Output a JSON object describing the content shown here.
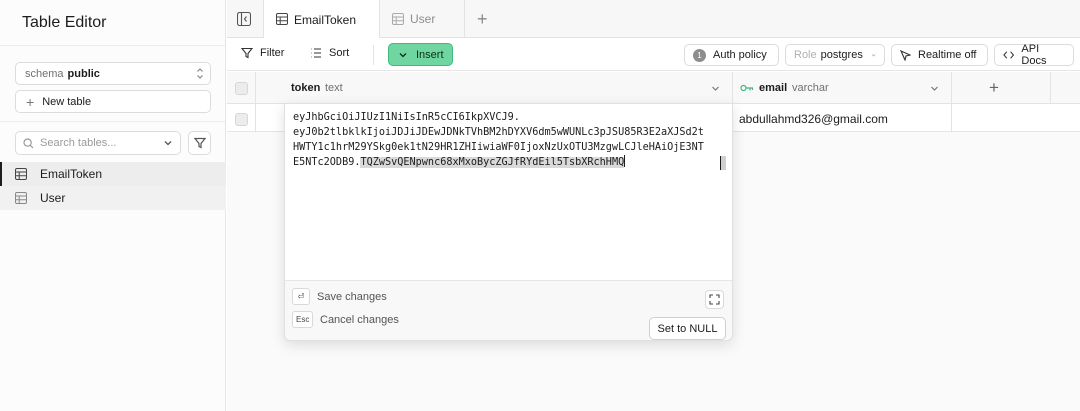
{
  "sidebar": {
    "title": "Table Editor",
    "schema": {
      "label": "schema",
      "value": "public"
    },
    "new_table_label": "New table",
    "search": {
      "placeholder": "Search tables..."
    },
    "tables": [
      {
        "name": "EmailToken",
        "active": true
      },
      {
        "name": "User",
        "active": false
      }
    ]
  },
  "tabs": [
    {
      "label": "EmailToken",
      "active": true
    },
    {
      "label": "User",
      "active": false
    }
  ],
  "toolbar": {
    "filter_label": "Filter",
    "sort_label": "Sort",
    "insert_label": "Insert",
    "auth_policy": {
      "count": "1",
      "label": "Auth policy"
    },
    "role": {
      "label": "Role",
      "value": "postgres"
    },
    "realtime_label": "Realtime off",
    "api_docs_label": "API Docs"
  },
  "grid": {
    "columns": [
      {
        "name": "token",
        "type": "text"
      },
      {
        "name": "email",
        "type": "varchar"
      }
    ],
    "rows": [
      {
        "email": "abdullahmd326@gmail.com"
      }
    ]
  },
  "editor": {
    "lines": [
      "eyJhbGciOiJIUzI1NiIsInR5cCI6IkpXVCJ9.",
      "eyJ0b2tlbklkIjoiJDJiJDEwJDNkTVhBM2hDYXV6dm5wWUNLc3pJSU85R3E2aXJSd2t",
      "HWTY1c1hrM29YSkg0ek1tN29HR1ZHIiwiaWF0IjoxNzUxOTU3MzgwLCJleHAiOjE3NT",
      "E5NTc2ODB9."
    ],
    "selected": "TQZwSvQENpwnc68xMxoBycZGJfRYdEil5TsbXRchHMQ",
    "save_key": "⏎",
    "save_label": "Save changes",
    "cancel_key": "Esc",
    "cancel_label": "Cancel changes",
    "null_label": "Set to NULL"
  },
  "colors": {
    "accent": "#6fd6a2",
    "accent_border": "#3fb97d"
  }
}
